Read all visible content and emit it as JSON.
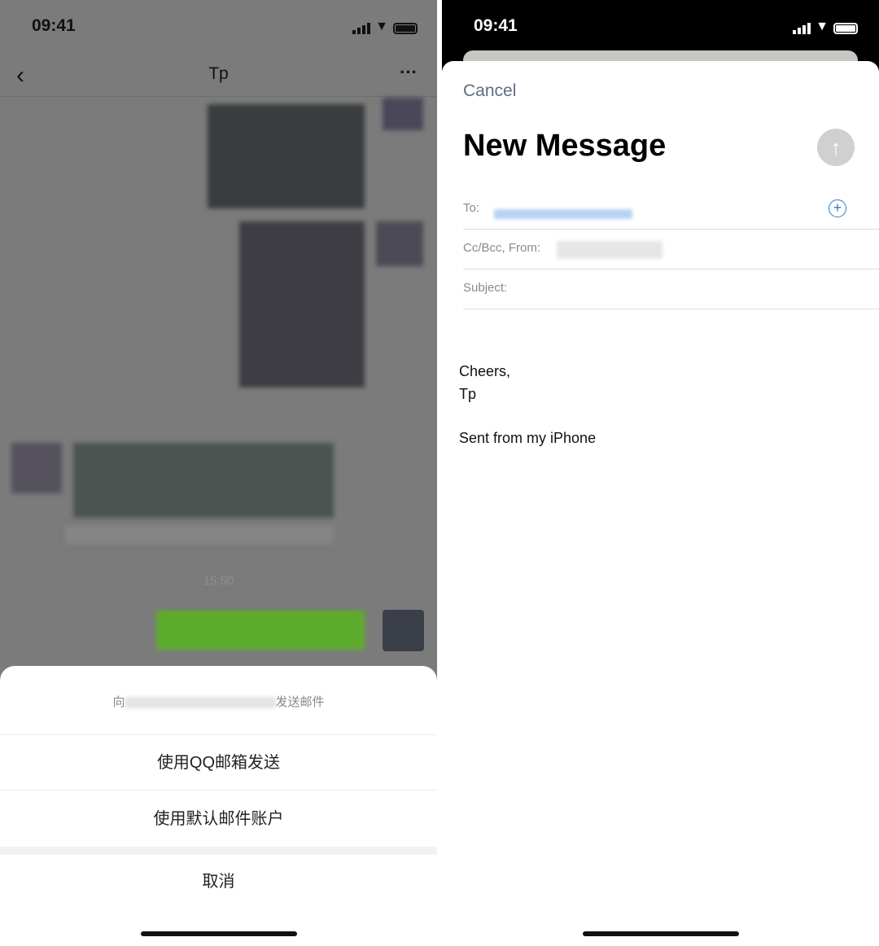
{
  "status_bar": {
    "time": "09:41"
  },
  "chat": {
    "title": "Tp",
    "timestamp": "15:50"
  },
  "action_sheet": {
    "header_prefix": "向",
    "header_suffix": "发送邮件",
    "options": [
      "使用QQ邮箱发送",
      "使用默认邮件账户"
    ],
    "cancel": "取消"
  },
  "compose": {
    "cancel": "Cancel",
    "title": "New Message",
    "to_label": "To:",
    "ccbcc_label": "Cc/Bcc, From:",
    "subject_label": "Subject:",
    "body_lines": [
      "Cheers,",
      "Tp"
    ],
    "signature": "Sent from my iPhone",
    "accent": "#3b6f9a"
  }
}
